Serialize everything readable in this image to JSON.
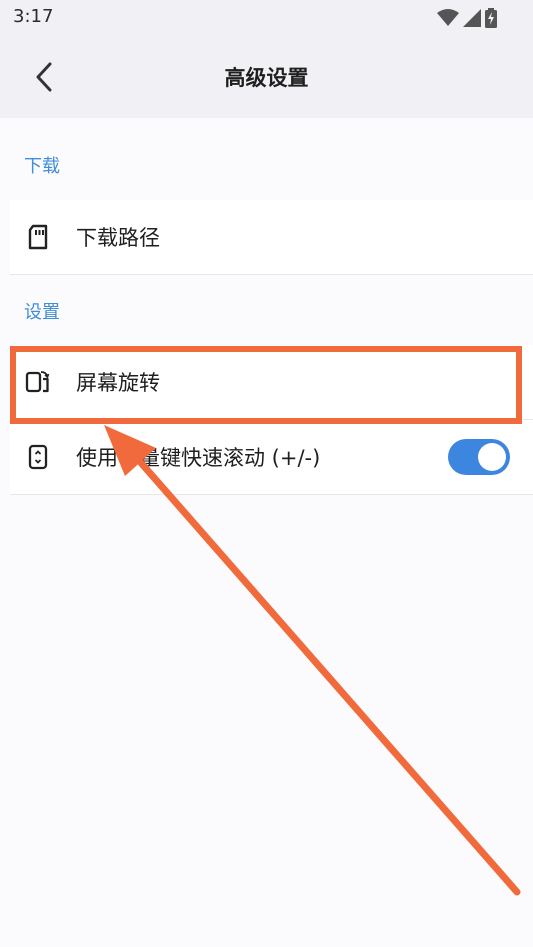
{
  "status_bar": {
    "time": "3:17",
    "icons": [
      "wifi-icon",
      "signal-icon",
      "battery-icon"
    ]
  },
  "app_bar": {
    "back_icon": "chevron-left-icon",
    "title": "高级设置"
  },
  "sections": [
    {
      "header": "下载",
      "items": [
        {
          "label": "下载路径",
          "icon": "sd-card-icon"
        }
      ]
    },
    {
      "header": "设置",
      "items": [
        {
          "label": "屏幕旋转",
          "icon": "screen-rotation-icon"
        },
        {
          "label": "使用音量键快速滚动 (+/-)",
          "icon": "phone-volume-icon",
          "toggle": true
        }
      ]
    }
  ],
  "colors": {
    "accent": "#3d86e0",
    "section_header": "#3f8ed9",
    "annotation": "#f06a3c"
  }
}
